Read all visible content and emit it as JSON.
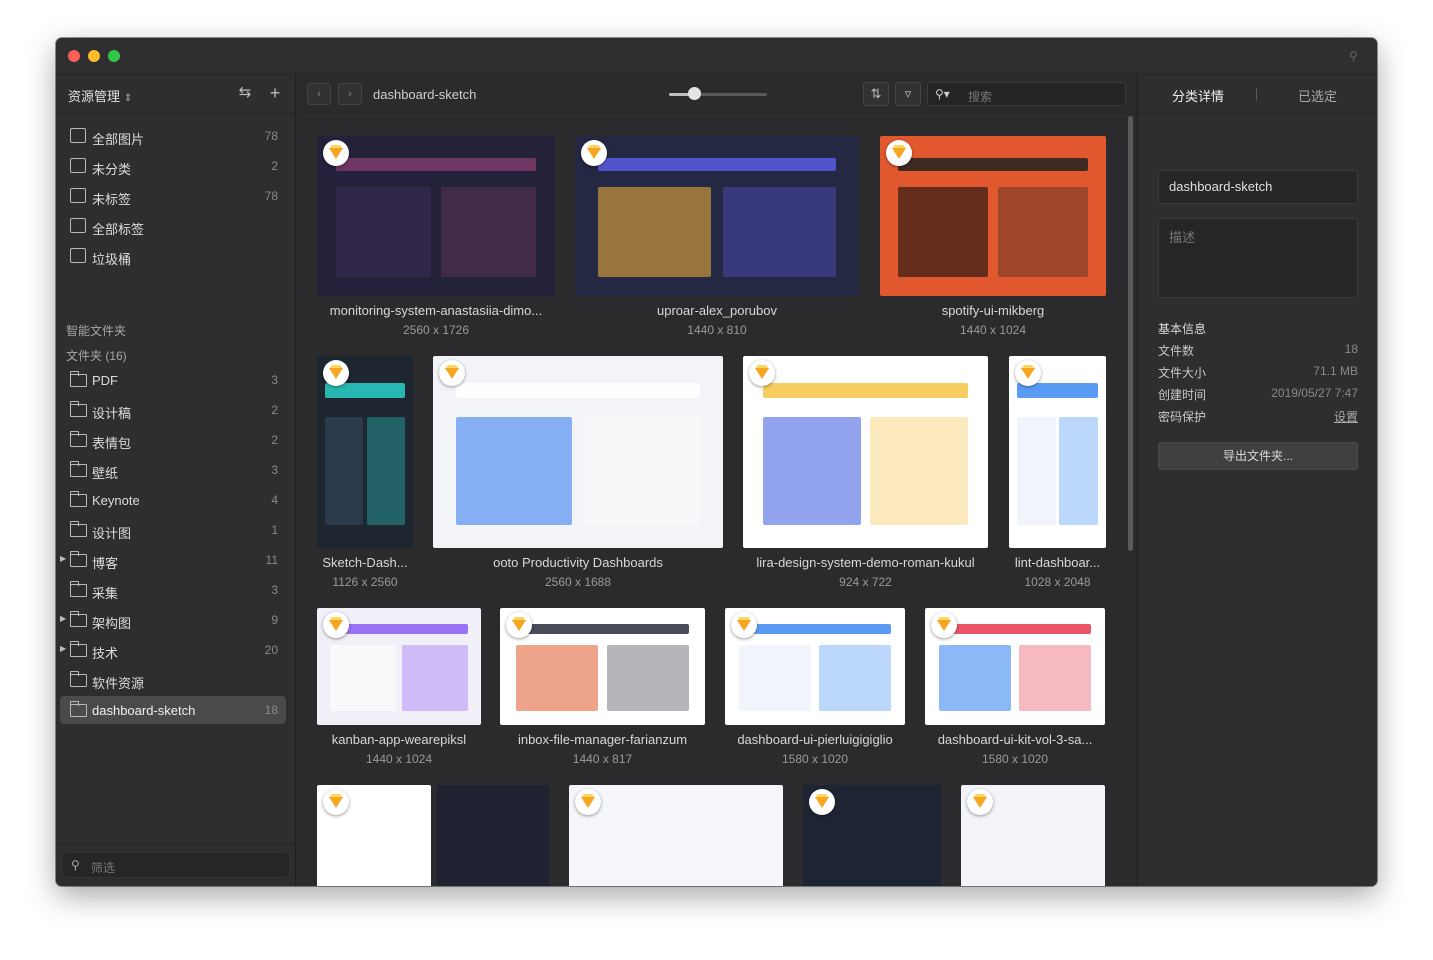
{
  "sidebar": {
    "title": "资源管理",
    "library": [
      {
        "label": "全部图片",
        "count": "78"
      },
      {
        "label": "未分类",
        "count": "2"
      },
      {
        "label": "未标签",
        "count": "78"
      },
      {
        "label": "全部标签",
        "count": ""
      },
      {
        "label": "垃圾桶",
        "count": ""
      }
    ],
    "smart_folders_label": "智能文件夹",
    "folders_label": "文件夹 (16)",
    "folders": [
      {
        "label": "PDF",
        "count": "3",
        "expandable": false
      },
      {
        "label": "设计稿",
        "count": "2",
        "expandable": false
      },
      {
        "label": "表情包",
        "count": "2",
        "expandable": false
      },
      {
        "label": "壁纸",
        "count": "3",
        "expandable": false
      },
      {
        "label": "Keynote",
        "count": "4",
        "expandable": false
      },
      {
        "label": "设计图",
        "count": "1",
        "expandable": false
      },
      {
        "label": "博客",
        "count": "11",
        "expandable": true
      },
      {
        "label": "采集",
        "count": "3",
        "expandable": false
      },
      {
        "label": "架构图",
        "count": "9",
        "expandable": true
      },
      {
        "label": "技术",
        "count": "20",
        "expandable": true
      },
      {
        "label": "软件资源",
        "count": "",
        "expandable": false
      },
      {
        "label": "dashboard-sketch",
        "count": "18",
        "expandable": false,
        "active": true
      }
    ],
    "filter_placeholder": "筛选"
  },
  "toolbar": {
    "back": "‹",
    "forward": "›",
    "path": "dashboard-sketch",
    "zoom_level": 0.25,
    "search_placeholder": "搜索"
  },
  "items": [
    {
      "name": "monitoring-system-anastasiia-dimo...",
      "dims": "2560 x 1726",
      "theme": "dark-purple"
    },
    {
      "name": "uproar-alex_porubov",
      "dims": "1440 x 810",
      "theme": "dark-blue"
    },
    {
      "name": "spotify-ui-mikberg",
      "dims": "1440 x 1024",
      "theme": "orange"
    },
    {
      "name": "Sketch-Dash...",
      "dims": "1126 x 2560",
      "theme": "dark-teal"
    },
    {
      "name": "ooto Productivity Dashboards",
      "dims": "2560 x 1688",
      "theme": "light"
    },
    {
      "name": "lira-design-system-demo-roman-kukul",
      "dims": "924 x 722",
      "theme": "yellow"
    },
    {
      "name": "lint-dashboar...",
      "dims": "1028 x 2048",
      "theme": "light-blue"
    },
    {
      "name": "kanban-app-wearepiksl",
      "dims": "1440 x 1024",
      "theme": "purple-light"
    },
    {
      "name": "inbox-file-manager-farianzum",
      "dims": "1440 x 817",
      "theme": "dark-light"
    },
    {
      "name": "dashboard-ui-pierluigigiglio",
      "dims": "1580 x 1020",
      "theme": "light-blue"
    },
    {
      "name": "dashboard-ui-kit-vol-3-sa...",
      "dims": "1580 x 1020",
      "theme": "light-red"
    }
  ],
  "right_panel": {
    "tab_details": "分类详情",
    "tab_selected": "已选定",
    "folder_name": "dashboard-sketch",
    "description_placeholder": "描述",
    "info_heading": "基本信息",
    "info": [
      {
        "key": "文件数",
        "value": "18"
      },
      {
        "key": "文件大小",
        "value": "71.1 MB"
      },
      {
        "key": "创建时间",
        "value": "2019/05/27 7:47"
      },
      {
        "key": "密码保护",
        "value": "设置",
        "link": true
      }
    ],
    "export_button": "导出文件夹..."
  },
  "colors": {
    "window_bg": "#2b2b2d",
    "sidebar_bg": "#2e2e30",
    "active_item": "#4a4a4d",
    "close": "#fc5f57",
    "minimize": "#fdbc2e",
    "zoom": "#33c748",
    "sketch_badge": "#f5a623"
  }
}
